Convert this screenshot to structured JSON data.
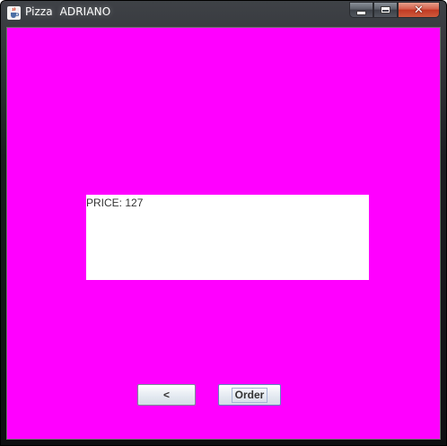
{
  "window": {
    "title": "Pizza  ADRIANO",
    "app_icon": "java-cup-icon",
    "background_color": "#ff00ff"
  },
  "titlebar_controls": {
    "minimize_icon": "minimize-icon",
    "maximize_icon": "maximize-icon",
    "close_icon": "close-icon",
    "close_glyph": "✕"
  },
  "price_panel": {
    "text": "PRICE: 127"
  },
  "buttons": {
    "back_label": "<",
    "order_label": "Order"
  }
}
